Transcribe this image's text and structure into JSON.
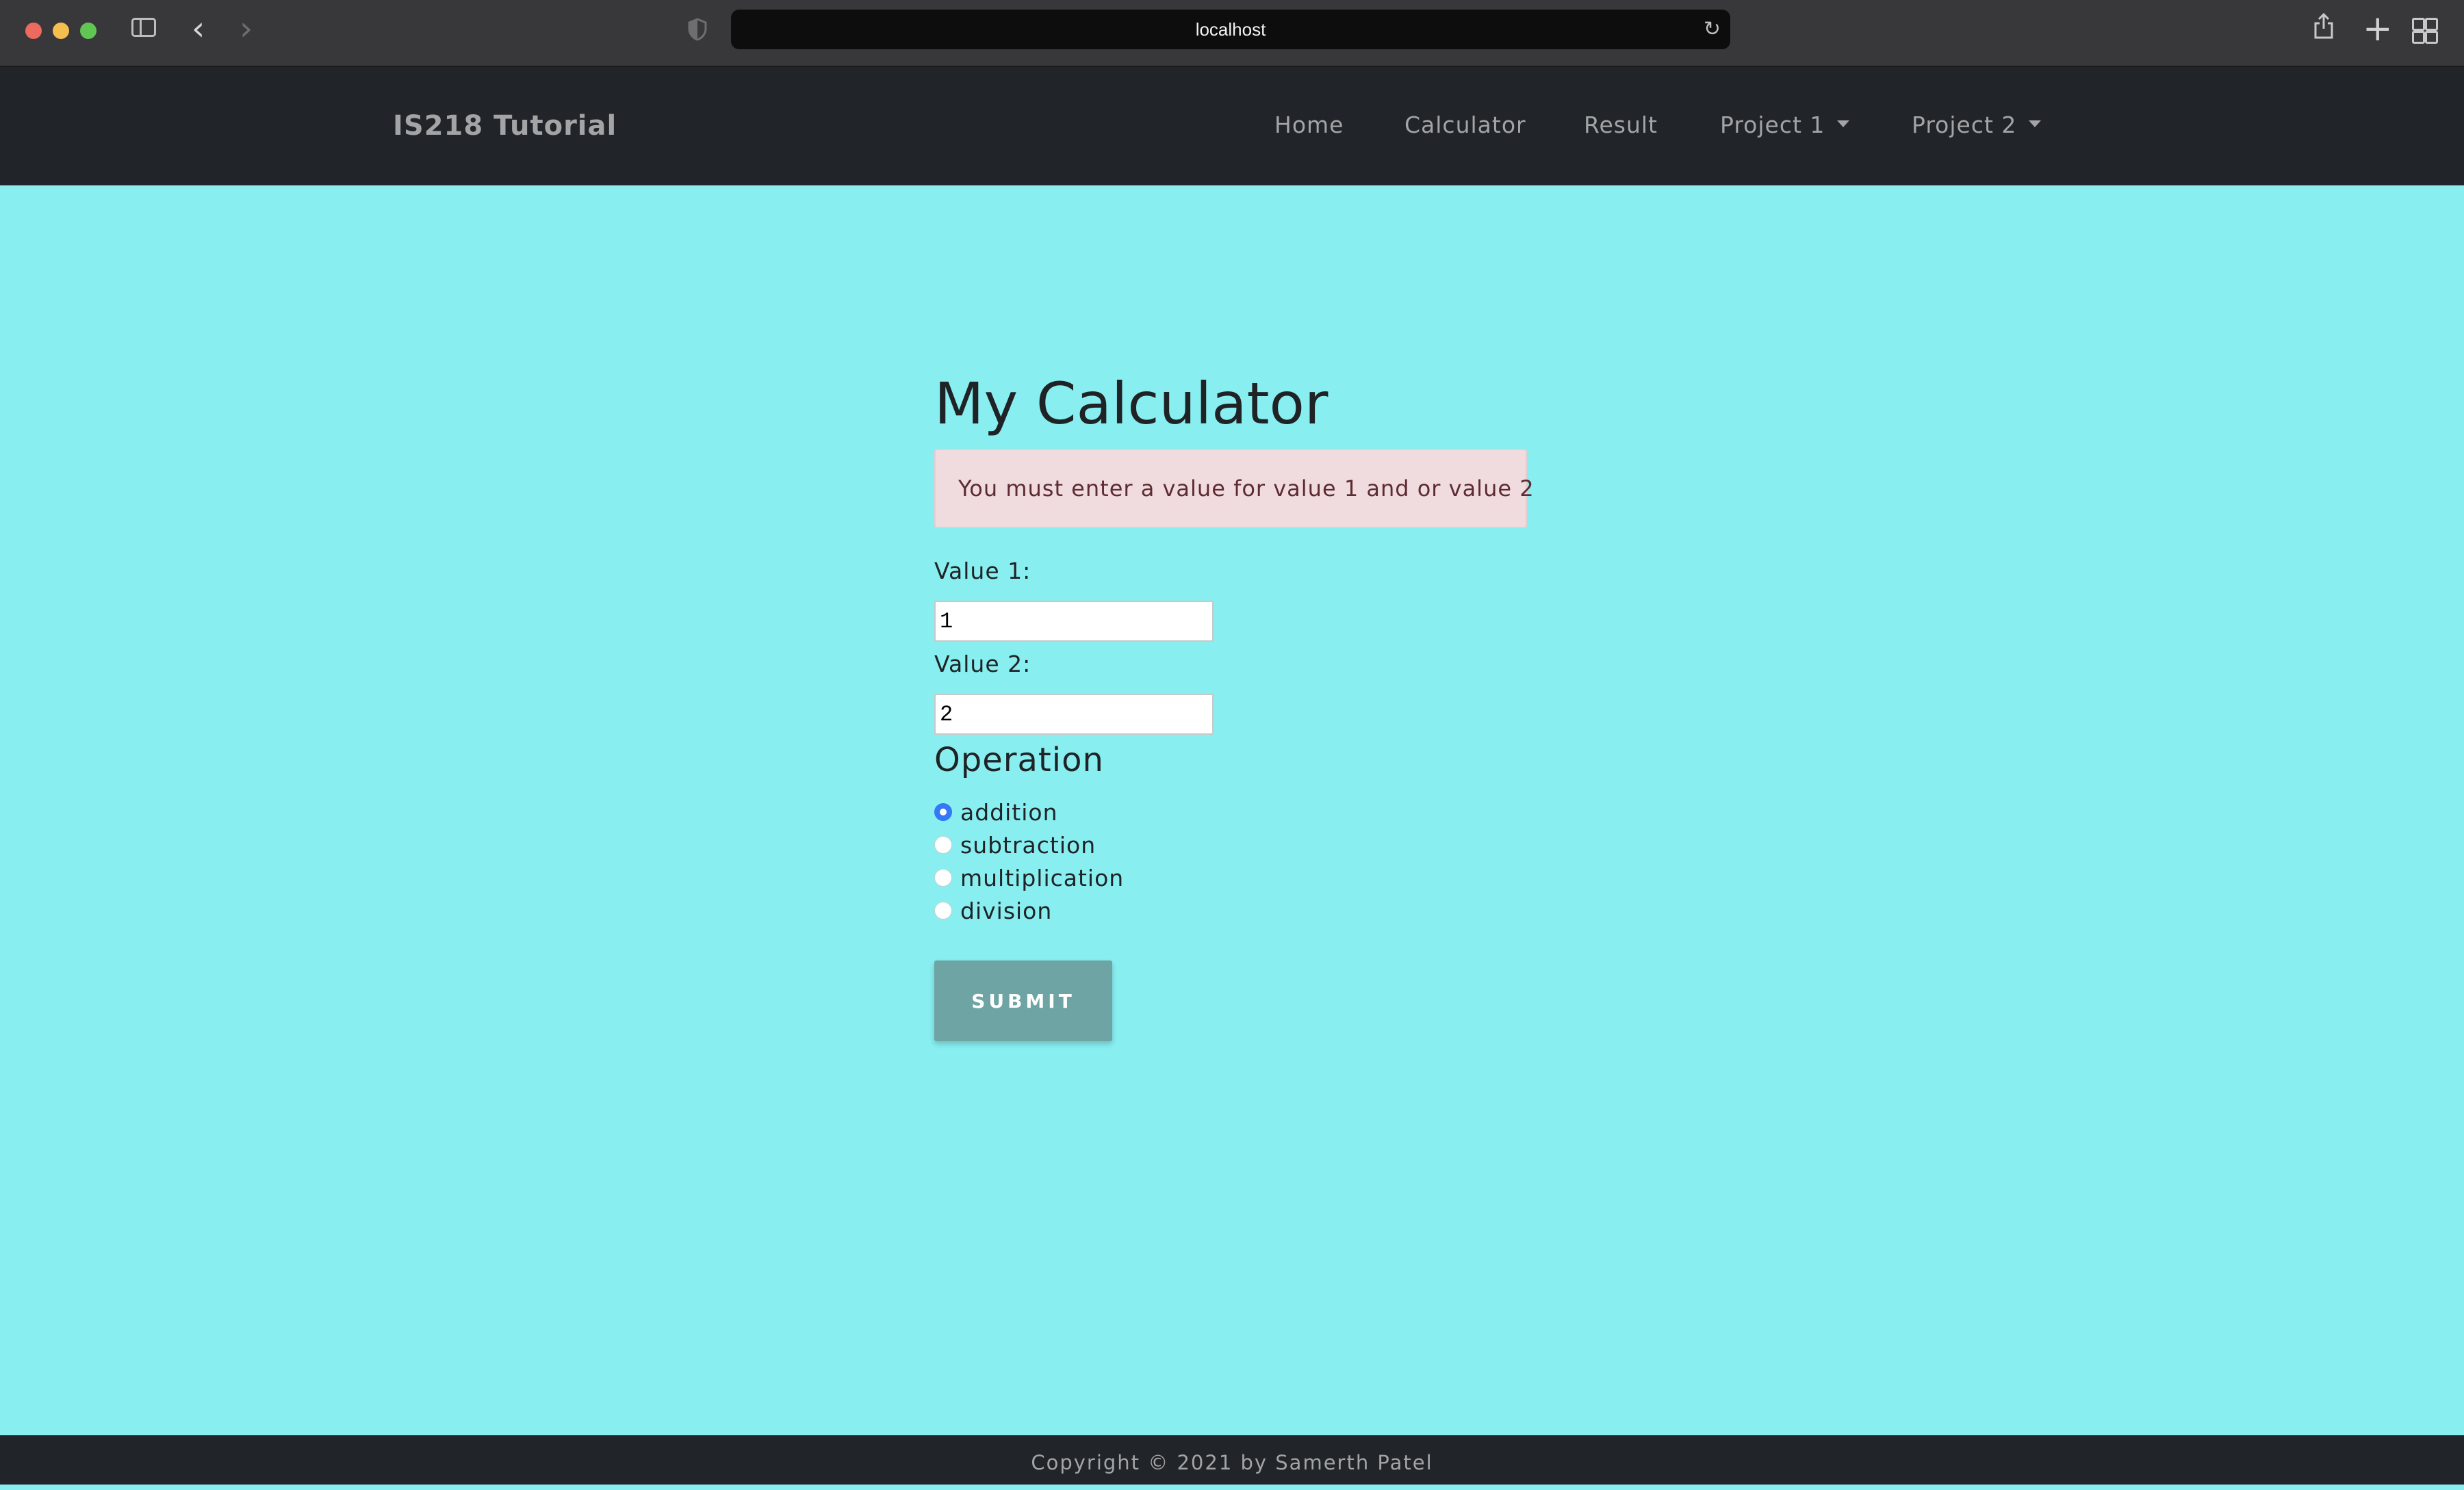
{
  "browser": {
    "url": "localhost"
  },
  "navbar": {
    "brand": "IS218 Tutorial",
    "links": [
      {
        "label": "Home"
      },
      {
        "label": "Calculator"
      },
      {
        "label": "Result"
      },
      {
        "label": "Project 1"
      },
      {
        "label": "Project 2"
      }
    ]
  },
  "main": {
    "title": "My Calculator",
    "alert": "You must enter a value for value 1 and or value 2",
    "value1": {
      "label": "Value 1:",
      "value": "1"
    },
    "value2": {
      "label": "Value 2:",
      "value": "2"
    },
    "operation": {
      "heading": "Operation",
      "options": [
        {
          "label": "addition",
          "checked": true
        },
        {
          "label": "subtraction",
          "checked": false
        },
        {
          "label": "multiplication",
          "checked": false
        },
        {
          "label": "division",
          "checked": false
        }
      ]
    },
    "submit_label": "SUBMIT"
  },
  "footer": {
    "text": "Copyright © 2021 by Samerth Patel"
  },
  "colors": {
    "page_background": "#88eef0",
    "navbar": "#212529",
    "alert_background": "#f0dcdf",
    "submit_button": "#6ea4a3",
    "radio_selected": "#3478f6"
  }
}
